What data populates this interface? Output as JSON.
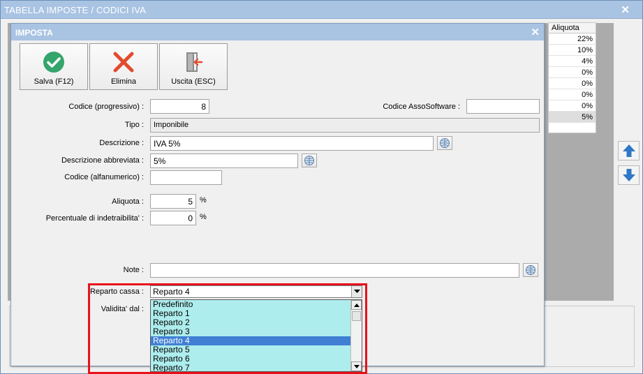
{
  "window": {
    "title": "TABELLA IMPOSTE / CODICI IVA"
  },
  "background_table": {
    "header": "Aliquota",
    "values": [
      "22%",
      "10%",
      "4%",
      "0%",
      "0%",
      "0%",
      "0%",
      "5%"
    ]
  },
  "dialog": {
    "title": "IMPOSTA"
  },
  "toolbar": {
    "save_label": "Salva (F12)",
    "delete_label": "Elimina",
    "exit_label": "Uscita (ESC)"
  },
  "form": {
    "codice_label": "Codice (progressivo) :",
    "codice_value": "8",
    "assosoftware_label": "Codice AssoSoftware :",
    "assosoftware_value": "",
    "tipo_label": "Tipo :",
    "tipo_value": "Imponibile",
    "descrizione_label": "Descrizione :",
    "descrizione_value": "IVA 5%",
    "descr_abbr_label": "Descrizione abbreviata :",
    "descr_abbr_value": "5%",
    "codice_alfa_label": "Codice (alfanumerico) :",
    "codice_alfa_value": "",
    "aliquota_label": "Aliquota :",
    "aliquota_value": "5",
    "indetraibilita_label": "Percentuale di indetraibilita' :",
    "indetraibilita_value": "0",
    "percent_sign": "%",
    "note_label": "Note :",
    "note_value": "",
    "reparto_label": "Reparto cassa :",
    "reparto_value": "Reparto 4",
    "validita_label": "Validita' dal :"
  },
  "reparto_options": [
    "Predefinito",
    "Reparto 1",
    "Reparto 2",
    "Reparto 3",
    "Reparto 4",
    "Reparto 5",
    "Reparto 6",
    "Reparto 7"
  ],
  "reparto_selected_index": 4,
  "colors": {
    "titlebar": "#a9c3e3",
    "highlight_frame": "#e8111a",
    "dropdown_bg": "#aeeded",
    "selection": "#3f7fd4"
  }
}
